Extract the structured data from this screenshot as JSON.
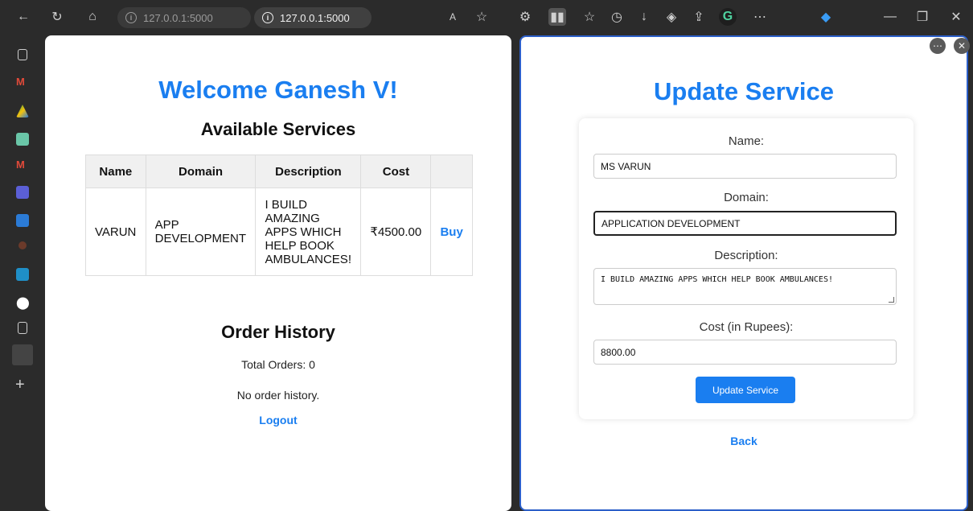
{
  "browser": {
    "tabs": [
      {
        "url": "127.0.0.1:5000"
      },
      {
        "url": "127.0.0.1:5000"
      }
    ]
  },
  "left": {
    "welcome": "Welcome Ganesh V!",
    "services_title": "Available Services",
    "columns": [
      "Name",
      "Domain",
      "Description",
      "Cost",
      ""
    ],
    "rows": [
      {
        "name": "VARUN",
        "domain": "APP DEVELOPMENT",
        "description": "I BUILD AMAZING APPS WHICH HELP BOOK AMBULANCES!",
        "cost": "₹4500.00",
        "action": "Buy"
      }
    ],
    "history_title": "Order History",
    "total_orders": "Total Orders: 0",
    "no_history": "No order history.",
    "logout": "Logout"
  },
  "right": {
    "title": "Update Service",
    "name_label": "Name:",
    "name_value": "MS VARUN",
    "domain_label": "Domain:",
    "domain_value": "APPLICATION DEVELOPMENT",
    "description_label": "Description:",
    "description_value": "I BUILD AMAZING APPS WHICH HELP BOOK AMBULANCES!",
    "cost_label": "Cost (in Rupees):",
    "cost_value": "8800.00",
    "submit": "Update Service",
    "back": "Back"
  },
  "colors": {
    "accent": "#1a7ef0",
    "split_border": "#2c5fc9"
  }
}
